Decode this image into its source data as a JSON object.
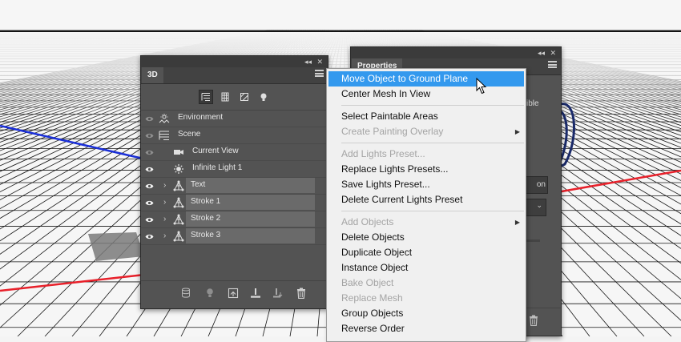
{
  "panel3d": {
    "title": "3D",
    "collapse_glyph": "◂◂",
    "close_glyph": "✕",
    "filters": [
      "scene-filter-icon",
      "mesh-filter-icon",
      "material-filter-icon",
      "light-filter-icon"
    ],
    "layers": [
      {
        "label": "Environment",
        "icon": "environment-icon",
        "indent": 0,
        "selected": false,
        "eye": "dim"
      },
      {
        "label": "Scene",
        "icon": "scene-icon",
        "indent": 0,
        "selected": false,
        "eye": "dim"
      },
      {
        "label": "Current View",
        "icon": "camera-icon",
        "indent": 1,
        "selected": false,
        "eye": "dim"
      },
      {
        "label": "Infinite Light 1",
        "icon": "infinite-light-icon",
        "indent": 1,
        "selected": false,
        "eye": "bright"
      },
      {
        "label": "Text",
        "icon": "mesh-icon",
        "indent": 1,
        "selected": true,
        "eye": "bright",
        "expandable": true
      },
      {
        "label": "Stroke 1",
        "icon": "mesh-icon",
        "indent": 1,
        "selected": true,
        "eye": "bright",
        "expandable": true
      },
      {
        "label": "Stroke 2",
        "icon": "mesh-icon",
        "indent": 1,
        "selected": true,
        "eye": "bright",
        "expandable": true
      },
      {
        "label": "Stroke 3",
        "icon": "mesh-icon",
        "indent": 1,
        "selected": true,
        "eye": "bright",
        "expandable": true
      }
    ],
    "bottom_icons": [
      "render-icon",
      "add-light-icon",
      "new-object-icon",
      "ground-plane-icon",
      "drop-to-plane-icon",
      "trash-icon"
    ]
  },
  "properties_panel": {
    "title": "Properties",
    "partial_texts": [
      "sible",
      "on"
    ],
    "collapse_glyph": "◂◂",
    "close_glyph": "✕"
  },
  "context_menu": {
    "items": [
      {
        "label": "Move Object to Ground Plane",
        "enabled": true,
        "highlighted": true
      },
      {
        "label": "Center Mesh In View",
        "enabled": true
      },
      {
        "separator": true
      },
      {
        "label": "Select Paintable Areas",
        "enabled": true
      },
      {
        "label": "Create Painting Overlay",
        "enabled": false,
        "submenu": true
      },
      {
        "separator": true
      },
      {
        "label": "Add Lights Preset...",
        "enabled": false
      },
      {
        "label": "Replace Lights Presets...",
        "enabled": true
      },
      {
        "label": "Save Lights Preset...",
        "enabled": true
      },
      {
        "label": "Delete Current Lights Preset",
        "enabled": true
      },
      {
        "separator": true
      },
      {
        "label": "Add Objects",
        "enabled": false,
        "submenu": true
      },
      {
        "label": "Delete Objects",
        "enabled": true
      },
      {
        "label": "Duplicate Object",
        "enabled": true
      },
      {
        "label": "Instance Object",
        "enabled": true
      },
      {
        "label": "Bake Object",
        "enabled": false
      },
      {
        "label": "Replace Mesh",
        "enabled": false
      },
      {
        "label": "Group Objects",
        "enabled": true
      },
      {
        "label": "Reverse Order",
        "enabled": true
      }
    ],
    "highlight_color": "#3399ee"
  },
  "colors": {
    "panel_bg": "#535353",
    "x_axis": "#e8202a",
    "z_axis": "#1a2fd8",
    "grid": "#151515"
  }
}
